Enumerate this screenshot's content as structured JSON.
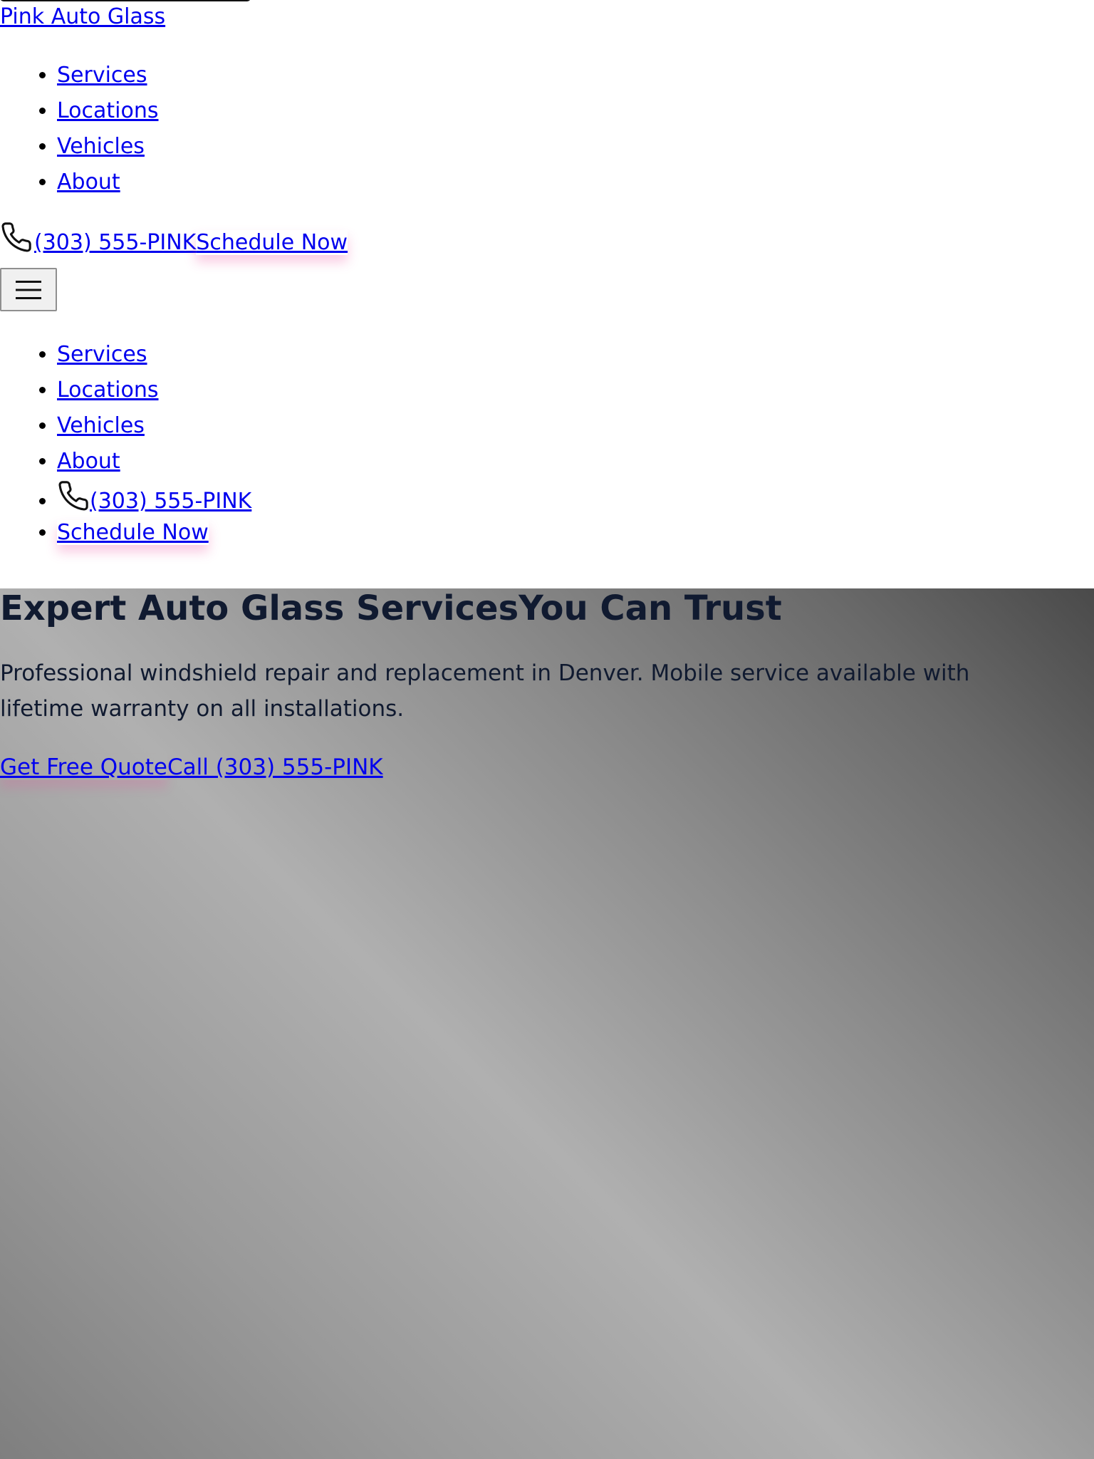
{
  "brand": {
    "name": "Pink Auto Glass",
    "accent": "#ec4899"
  },
  "nav": {
    "items": [
      {
        "label": "Services"
      },
      {
        "label": "Locations"
      },
      {
        "label": "Vehicles"
      },
      {
        "label": "About"
      }
    ],
    "phone_label": "(303) 555-PINK",
    "schedule_label": "Schedule Now",
    "phone_icon": "phone-icon",
    "menu_icon": "hamburger-menu-icon"
  },
  "mobile_nav": {
    "items": [
      {
        "label": "Services"
      },
      {
        "label": "Locations"
      },
      {
        "label": "Vehicles"
      },
      {
        "label": "About"
      }
    ],
    "phone_label": "(303) 555-PINK",
    "schedule_label": "Schedule Now"
  },
  "hero": {
    "title_part1": "Expert Auto Glass Services",
    "title_part2": "You Can Trust",
    "description": "Professional windshield repair and replacement in Denver. Mobile service available with lifetime warranty on all installations.",
    "quote_button": "Get Free Quote",
    "call_button": "Call (303) 555-PINK",
    "text_color": "#101a30"
  }
}
